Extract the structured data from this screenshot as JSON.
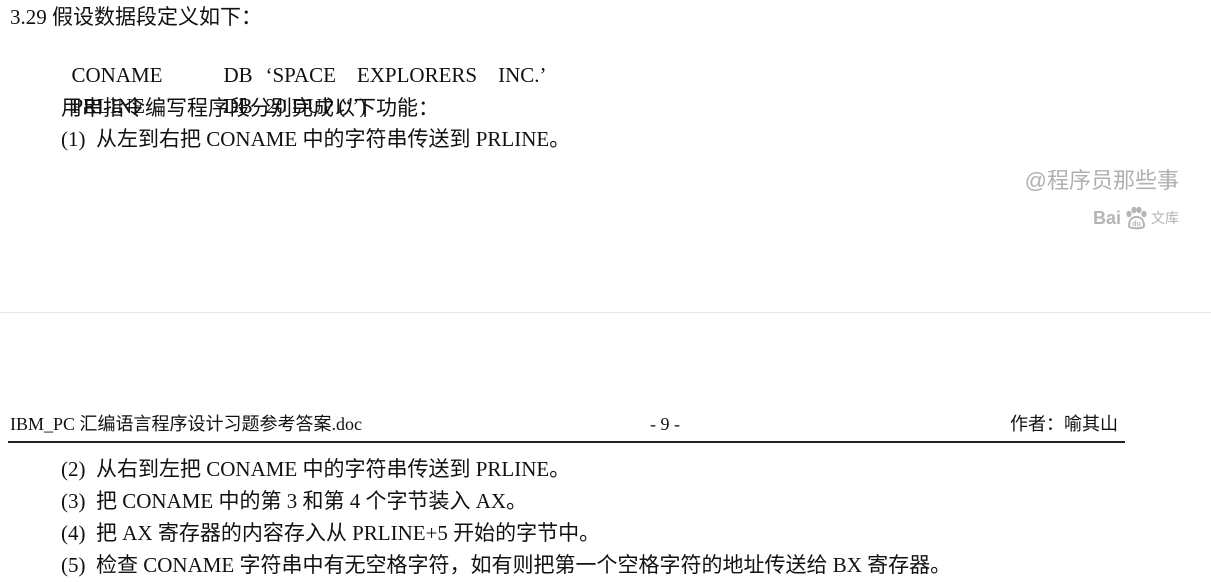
{
  "top": {
    "question_title": "3.29 假设数据段定义如下：",
    "line_coname": {
      "name": "CONAME",
      "directive": "DB",
      "value": "‘SPACE    EXPLORERS    INC.’"
    },
    "line_prline": {
      "name": "PRLINE",
      "directive": "DB",
      "value": "20 DUP (‘’)"
    },
    "instruction": "用串指令编写程序段分别完成以下功能：",
    "item1": "(1)  从左到右把 CONAME 中的字符串传送到 PRLINE。"
  },
  "watermark": {
    "text": "@程序员那些事",
    "baidu_brand": "Bai",
    "baidu_brand_tail": "文库"
  },
  "page_header": {
    "doc_title": "IBM_PC 汇编语言程序设计习题参考答案.doc",
    "page_number": "- 9 -",
    "author": "作者：喻其山"
  },
  "bottom": {
    "items": [
      "(2)  从右到左把 CONAME 中的字符串传送到 PRLINE。",
      "(3)  把 CONAME 中的第 3 和第 4 个字节装入 AX。",
      "(4)  把 AX 寄存器的内容存入从 PRLINE+5 开始的字节中。",
      "(5)  检查 CONAME 字符串中有无空格字符，如有则把第一个空格字符的地址传送给 BX 寄存器。"
    ]
  },
  "colors": {
    "text": "#111111",
    "watermark": "#b0b0b0",
    "rule": "#222222"
  }
}
